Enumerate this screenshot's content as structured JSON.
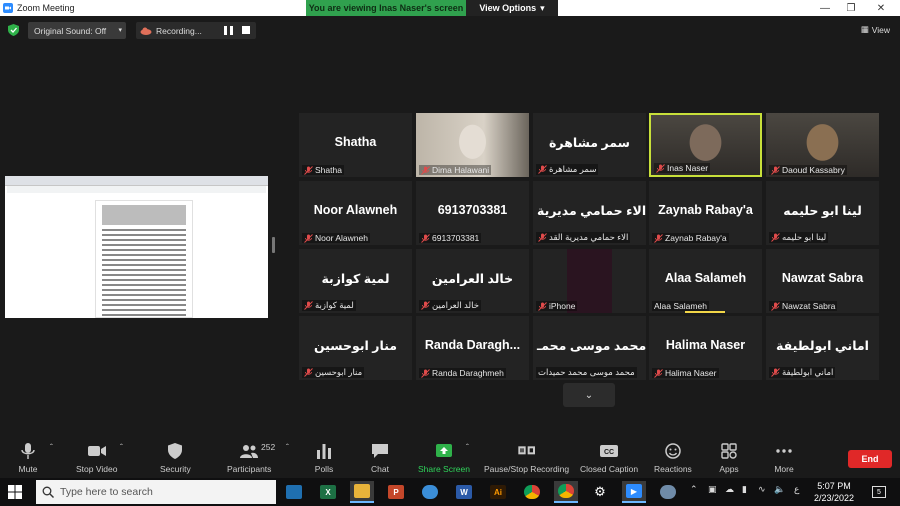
{
  "window": {
    "title": "Zoom Meeting"
  },
  "banner": {
    "message": "You are viewing Inas Naser's screen",
    "options": "View Options"
  },
  "topbar": {
    "original_sound": "Original Sound: Off",
    "recording": "Recording...",
    "view": "View"
  },
  "tiles": [
    {
      "display": "Shatha",
      "label": "Shatha",
      "video": false
    },
    {
      "display": "",
      "label": "Dima Halawani",
      "video": true,
      "tone": "#c9bfb6"
    },
    {
      "display": "سمر مشاهرة",
      "label": "سمر مشاهرة",
      "video": false
    },
    {
      "display": "",
      "label": "Inas Naser",
      "video": true,
      "tone": "#7d6a5b",
      "speaking": true
    },
    {
      "display": "",
      "label": "Daoud Kassabry",
      "video": true,
      "tone": "#8a6f52"
    },
    {
      "display": "Noor Alawneh",
      "label": "Noor Alawneh",
      "video": false
    },
    {
      "display": "6913703381",
      "label": "6913703381",
      "video": false
    },
    {
      "display": "الاء حمامي مديرية",
      "label": "الاء حمامي مديرية القد",
      "video": false
    },
    {
      "display": "Zaynab Rabay'a",
      "label": "Zaynab Rabay'a",
      "video": false
    },
    {
      "display": "لينا ابو حليمه",
      "label": "لينا ابو حليمه",
      "video": false
    },
    {
      "display": "لمية كوازبة",
      "label": "لمية كوازبة",
      "video": false
    },
    {
      "display": "خالد العرامين",
      "label": "خالد العرامين",
      "video": false
    },
    {
      "display": "",
      "label": "iPhone",
      "video": true,
      "tone": "#2a1620"
    },
    {
      "display": "Alaa Salameh",
      "label": "Alaa Salameh",
      "video": false,
      "talking": true,
      "nomute": true
    },
    {
      "display": "Nawzat Sabra",
      "label": "Nawzat Sabra",
      "video": false
    },
    {
      "display": "منار ابوحسين",
      "label": "منار ابوحسين",
      "video": false
    },
    {
      "display": "Randa  Daragh...",
      "label": "Randa Daraghmeh",
      "video": false
    },
    {
      "display": "محمد موسى محمـ...",
      "label": "محمد موسى محمد حميدات",
      "video": false,
      "nomute": true
    },
    {
      "display": "Halima Naser",
      "label": "Halima Naser",
      "video": false
    },
    {
      "display": "اماني ابولطيفة",
      "label": "اماني ابولطيفة",
      "video": false
    }
  ],
  "controls": {
    "mute": "Mute",
    "stop_video": "Stop Video",
    "security": "Security",
    "participants": "Participants",
    "participants_count": "252",
    "polls": "Polls",
    "chat": "Chat",
    "share_screen": "Share Screen",
    "pause_recording": "Pause/Stop Recording",
    "closed_caption": "Closed Caption",
    "reactions": "Reactions",
    "apps": "Apps",
    "more": "More",
    "end": "End"
  },
  "taskbar": {
    "search_placeholder": "Type here to search",
    "time": "5:07 PM",
    "date": "2/23/2022",
    "lang": "ع",
    "notifications": "5"
  },
  "colors": {
    "accent_green": "#30a14e",
    "end_red": "#e02828",
    "speaker_border": "#c8e03a"
  }
}
